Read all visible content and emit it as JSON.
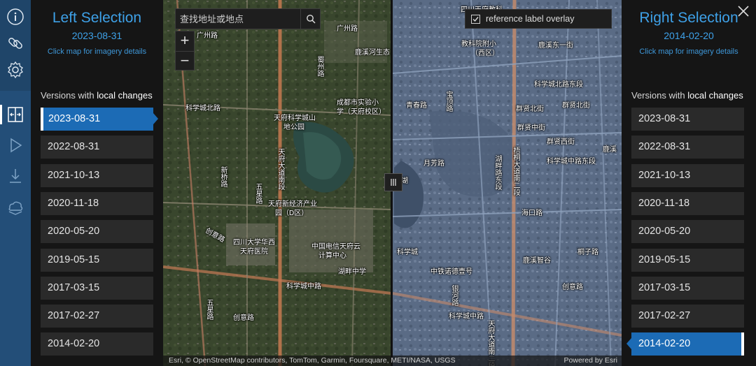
{
  "left_panel": {
    "title": "Left Selection",
    "selected_date": "2023-08-31",
    "hint": "Click map for imagery details",
    "versions_prefix": "Versions with",
    "versions_highlight": "local changes",
    "versions": [
      "2023-08-31",
      "2022-08-31",
      "2021-10-13",
      "2020-11-18",
      "2020-05-20",
      "2019-05-15",
      "2017-03-15",
      "2017-02-27",
      "2014-02-20"
    ],
    "selected_index": 0
  },
  "right_panel": {
    "title": "Right Selection",
    "selected_date": "2014-02-20",
    "hint": "Click map for imagery details",
    "versions_prefix": "Versions with",
    "versions_highlight": "local changes",
    "versions": [
      "2023-08-31",
      "2022-08-31",
      "2021-10-13",
      "2020-11-18",
      "2020-05-20",
      "2019-05-15",
      "2017-03-15",
      "2017-02-27",
      "2014-02-20"
    ],
    "selected_index": 8
  },
  "map": {
    "search_placeholder": "查找地址或地点",
    "zoom_in": "+",
    "zoom_out": "−",
    "overlay_label": "reference label overlay",
    "overlay_checked": true,
    "attribution": "Esri, © OpenStreetMap contributors, TomTom, Garmin, Foursquare, METI/NASA, USGS",
    "powered_by": "Powered by Esri",
    "labels_left": {
      "guangzhou1": "广州路",
      "guangzhou2": "广州路",
      "shu": "蜀州路",
      "kexue1": "科学城北路",
      "tianfu1": "天府科学城山",
      "tianfu2": "地公园",
      "chengdu1": "成都市实验小",
      "chengdu2": "学（天府校区）",
      "tianfu_ave": "天府大道南段",
      "wuxing": "五星路",
      "xinqiao": "新桥路",
      "jingji1": "天府新经济产业",
      "jingji2": "园（D区）",
      "sichuan1": "四川大学华西",
      "sichuan2": "天府医院",
      "zhongdian1": "中国电信天府云",
      "zhongdian2": "计算中心",
      "hupan": "湖畔中学",
      "kexue2": "科学城中路",
      "chuangxin1": "创意路",
      "chuangxin2": "创意路",
      "wuxing2": "五星路",
      "lu1": "鹿溪河生态"
    },
    "labels_right": {
      "jiaoke1": "四川天府教科",
      "jiaoke2": "教科院附小",
      "jiaoke3": "（西区）",
      "ludong": "鹿溪东一街",
      "kexue_east": "科学城北路东段",
      "qinchun": "青春路",
      "baoding": "宝顶路",
      "qunxian1": "群贤北街",
      "qunxian2": "群贤北街",
      "qunxian3": "群贤中街",
      "qunxian4": "群贤西街",
      "hutu": "湖畔路东段",
      "yuefang": "月芳路",
      "wutong": "梧桐大道南二段",
      "kechuang": "科学城中路东段",
      "haikou": "海口路",
      "luxi": "鹿溪智谷",
      "zhongtie": "中铁诺德壹号",
      "yinhe": "银河路",
      "kexue_mid": "科学城中路",
      "chuangyi": "创意路",
      "tongzi": "桐子路",
      "tianfu3": "天府大道南二段",
      "hu": "湖",
      "lu1": "鹿溪",
      "kexue_city": "科学城"
    }
  },
  "colors": {
    "accent": "#3ea1e8",
    "selected": "#1c6bb5",
    "rail": "#234e78"
  }
}
